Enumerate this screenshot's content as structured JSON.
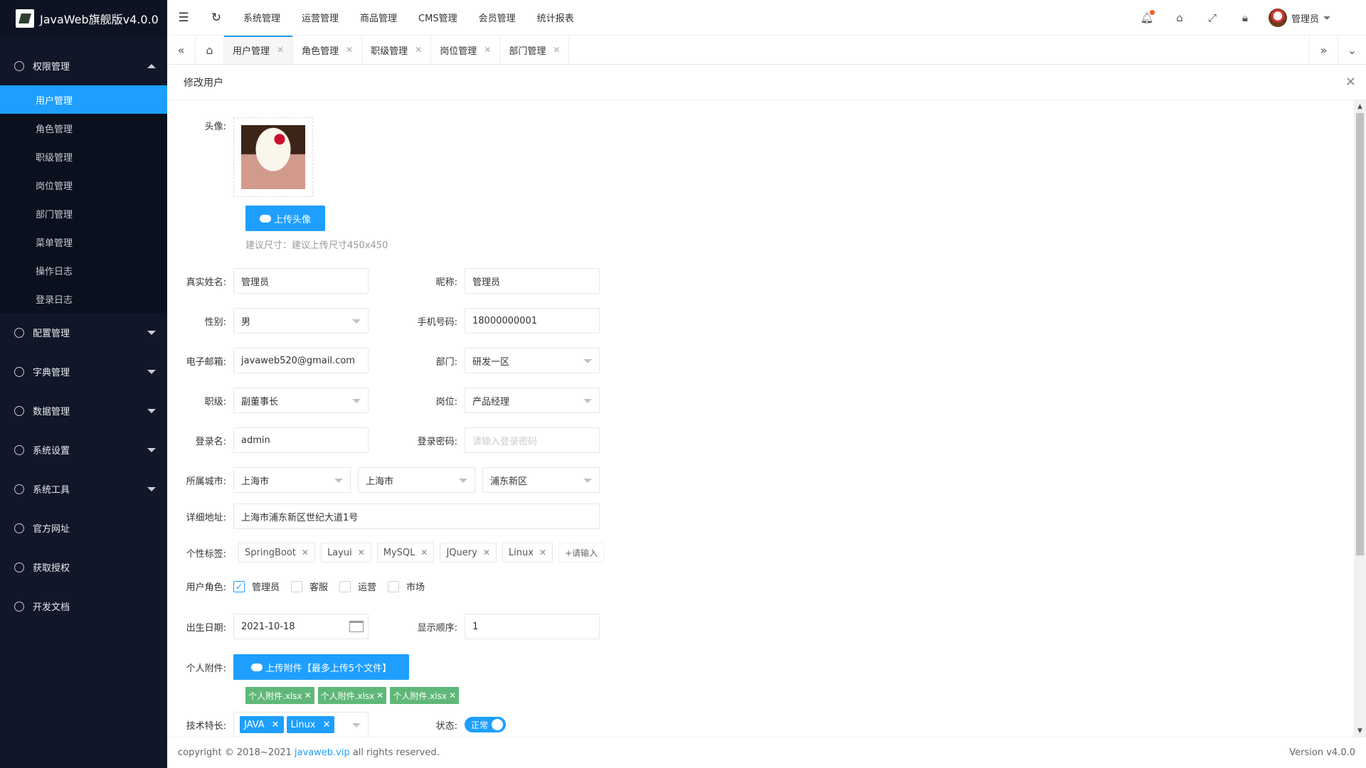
{
  "app": {
    "title": "JavaWeb旗舰版v4.0.0"
  },
  "sidebar": {
    "groups": [
      {
        "label": "权限管理",
        "icon": "gear-icon"
      },
      {
        "label": "配置管理",
        "icon": "gear-icon"
      },
      {
        "label": "字典管理",
        "icon": "dict-icon"
      },
      {
        "label": "数据管理",
        "icon": "data-icon"
      },
      {
        "label": "系统设置",
        "icon": "home-icon"
      },
      {
        "label": "系统工具",
        "icon": "gear-icon"
      },
      {
        "label": "官方网址",
        "icon": "link-icon"
      },
      {
        "label": "获取授权",
        "icon": "gear-icon"
      },
      {
        "label": "开发文档",
        "icon": "book-icon"
      }
    ],
    "submenu": [
      "用户管理",
      "角色管理",
      "职级管理",
      "岗位管理",
      "部门管理",
      "菜单管理",
      "操作日志",
      "登录日志"
    ]
  },
  "topnav": [
    "系统管理",
    "运营管理",
    "商品管理",
    "CMS管理",
    "会员管理",
    "统计报表"
  ],
  "user": {
    "name": "管理员"
  },
  "tabs": [
    {
      "label": "用户管理",
      "active": true
    },
    {
      "label": "角色管理"
    },
    {
      "label": "职级管理"
    },
    {
      "label": "岗位管理"
    },
    {
      "label": "部门管理"
    }
  ],
  "panel": {
    "title": "修改用户"
  },
  "form": {
    "avatar": {
      "label": "头像:",
      "upload_button": "上传头像",
      "hint": "建议尺寸：建议上传尺寸450x450"
    },
    "realname": {
      "label": "真实姓名:",
      "value": "管理员"
    },
    "nickname": {
      "label": "昵称:",
      "value": "管理员"
    },
    "gender": {
      "label": "性别:",
      "value": "男"
    },
    "mobile": {
      "label": "手机号码:",
      "value": "18000000001"
    },
    "email": {
      "label": "电子邮箱:",
      "value": "javaweb520@gmail.com"
    },
    "dept": {
      "label": "部门:",
      "value": "研发一区"
    },
    "level": {
      "label": "职级:",
      "value": "副董事长"
    },
    "position": {
      "label": "岗位:",
      "value": "产品经理"
    },
    "username": {
      "label": "登录名:",
      "value": "admin"
    },
    "password": {
      "label": "登录密码:",
      "placeholder": "请输入登录密码"
    },
    "city": {
      "label": "所属城市:",
      "province": "上海市",
      "city": "上海市",
      "district": "浦东新区"
    },
    "address": {
      "label": "详细地址:",
      "value": "上海市浦东新区世纪大道1号"
    },
    "tags": {
      "label": "个性标签:",
      "items": [
        "SpringBoot",
        "Layui",
        "MySQL",
        "JQuery",
        "Linux"
      ],
      "add": "+请输入"
    },
    "roles": {
      "label": "用户角色:",
      "items": [
        {
          "label": "管理员",
          "checked": true
        },
        {
          "label": "客服",
          "checked": false
        },
        {
          "label": "运营",
          "checked": false
        },
        {
          "label": "市场",
          "checked": false
        }
      ]
    },
    "birthday": {
      "label": "出生日期:",
      "value": "2021-10-18"
    },
    "sort": {
      "label": "显示顺序:",
      "value": "1"
    },
    "attachment": {
      "label": "个人附件:",
      "upload_button": "上传附件【最多上传5个文件】",
      "files": [
        "个人附件.xlsx",
        "个人附件.xlsx",
        "个人附件.xlsx"
      ]
    },
    "skills": {
      "label": "技术特长:",
      "items": [
        "JAVA",
        "Linux"
      ]
    },
    "status": {
      "label": "状态:",
      "value": "正常"
    }
  },
  "footer": {
    "copyright": "copyright © 2018~2021",
    "link": "javaweb.vip",
    "rights": "all rights reserved.",
    "version": "Version v4.0.0"
  }
}
